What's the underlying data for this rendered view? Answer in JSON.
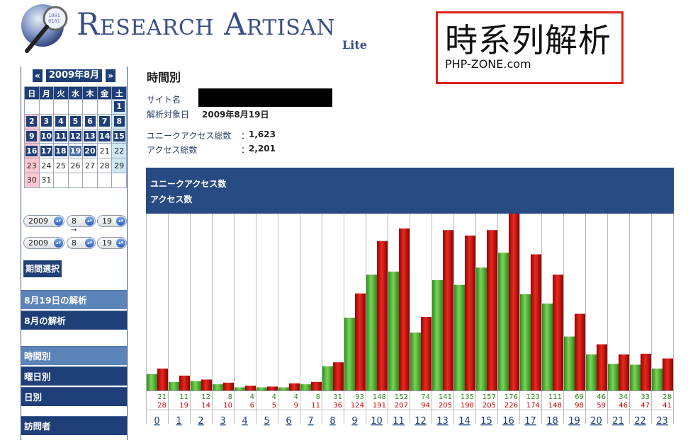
{
  "header": {
    "logo_title": "Research Artisan",
    "logo_sub": "Lite",
    "banner_title": "時系列解析",
    "banner_sub": "PHP-ZONE.com"
  },
  "calendar": {
    "prev": "«",
    "next": "»",
    "month_label": "2009年8月",
    "weekdays": [
      "日",
      "月",
      "火",
      "水",
      "木",
      "金",
      "土"
    ],
    "weeks": [
      [
        "",
        "",
        "",
        "",
        "",
        "",
        "1"
      ],
      [
        "2",
        "3",
        "4",
        "5",
        "6",
        "7",
        "8"
      ],
      [
        "9",
        "10",
        "11",
        "12",
        "13",
        "14",
        "15"
      ],
      [
        "16",
        "17",
        "18",
        "19",
        "20",
        "21",
        "22"
      ],
      [
        "23",
        "24",
        "25",
        "26",
        "27",
        "28",
        "29"
      ],
      [
        "30",
        "31",
        "",
        "",
        "",
        "",
        ""
      ]
    ],
    "linked_days": [
      "1",
      "2",
      "3",
      "4",
      "5",
      "6",
      "7",
      "8",
      "9",
      "10",
      "11",
      "12",
      "13",
      "14",
      "15",
      "16",
      "17",
      "18",
      "19",
      "20"
    ],
    "selected_day": "19"
  },
  "range": {
    "from": {
      "year": "2009",
      "month": "8",
      "day": "19"
    },
    "to": {
      "year": "2009",
      "month": "8",
      "day": "19"
    },
    "arrow": "→",
    "button": "期間選択"
  },
  "menu": {
    "day_analysis": "8月19日の解析",
    "month_analysis": "8月の解析",
    "hourly": "時間別",
    "weekday": "曜日別",
    "daily": "日別",
    "visitors": "訪問者"
  },
  "main": {
    "title": "時間別",
    "site_label": "サイト名",
    "date_label": "解析対象日",
    "date_value": "2009年8月19日",
    "unique_label": "ユニークアクセス総数",
    "unique_value": "1,623",
    "total_label": "アクセス総数",
    "total_value": "2,201",
    "colon": "：",
    "legend_unique": "ユニークアクセス数",
    "legend_total": "アクセス数"
  },
  "colors": {
    "unique": "#33aa22",
    "total": "#cc0000",
    "header_bg": "#274a83"
  },
  "chart_data": {
    "type": "bar",
    "categories": [
      "0",
      "1",
      "2",
      "3",
      "4",
      "5",
      "6",
      "7",
      "8",
      "9",
      "10",
      "11",
      "12",
      "13",
      "14",
      "15",
      "16",
      "17",
      "18",
      "19",
      "20",
      "21",
      "22",
      "23"
    ],
    "series": [
      {
        "name": "ユニークアクセス数",
        "values": [
          21,
          11,
          12,
          8,
          4,
          4,
          4,
          8,
          31,
          93,
          148,
          152,
          74,
          141,
          135,
          157,
          176,
          123,
          111,
          69,
          46,
          34,
          33,
          28
        ]
      },
      {
        "name": "アクセス数",
        "values": [
          28,
          19,
          14,
          10,
          6,
          5,
          9,
          11,
          36,
          124,
          191,
          207,
          94,
          205,
          198,
          205,
          226,
          174,
          148,
          98,
          59,
          46,
          47,
          41
        ]
      }
    ],
    "ylim": [
      0,
      226
    ]
  }
}
